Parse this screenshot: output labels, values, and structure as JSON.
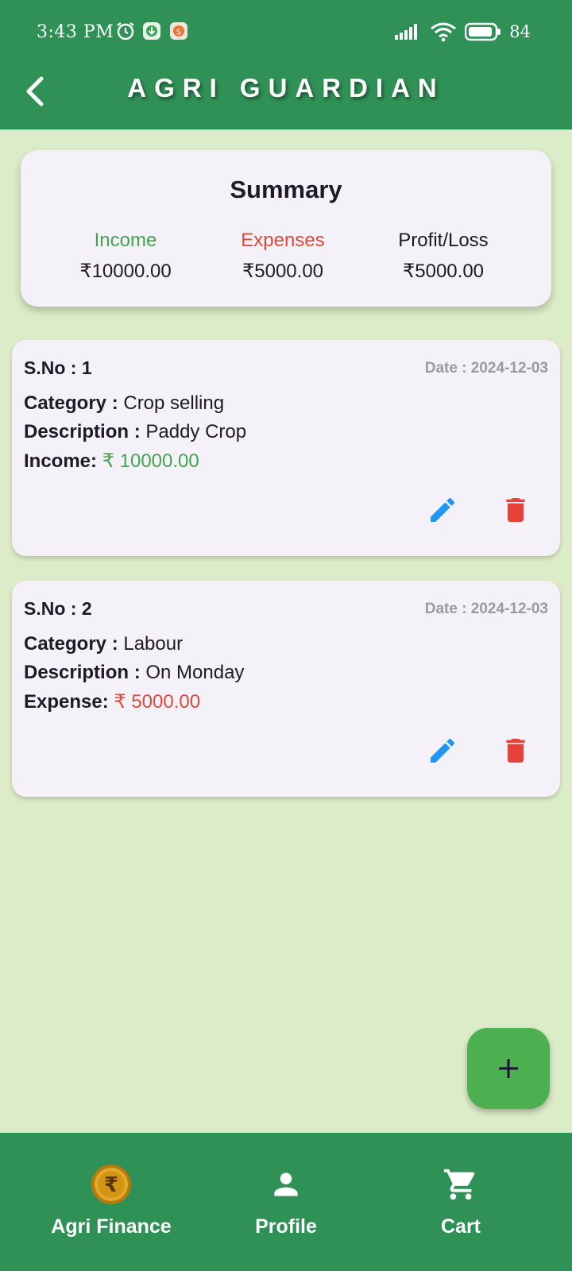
{
  "status_bar": {
    "time": "3:43 PM",
    "battery": "84"
  },
  "header": {
    "title": "AGRI GUARDIAN"
  },
  "summary": {
    "title": "Summary",
    "income_label": "Income",
    "income_value": "₹10000.00",
    "expenses_label": "Expenses",
    "expenses_value": "₹5000.00",
    "profit_label": "Profit/Loss",
    "profit_value": "₹5000.00"
  },
  "transactions": [
    {
      "sno": "S.No : 1",
      "date": "Date : 2024-12-03",
      "category_label": "Category :",
      "category": "Crop selling",
      "description_label": "Description :",
      "description": "Paddy Crop",
      "amount_label": "Income:",
      "amount": "₹ 10000.00",
      "type": "income"
    },
    {
      "sno": "S.No : 2",
      "date": "Date : 2024-12-03",
      "category_label": "Category :",
      "category": "Labour",
      "description_label": "Description :",
      "description": "On Monday",
      "amount_label": "Expense:",
      "amount": "₹ 5000.00",
      "type": "expense"
    }
  ],
  "bottom_nav": [
    {
      "label": "Agri Finance",
      "icon": "rupee-coin-icon"
    },
    {
      "label": "Profile",
      "icon": "person-icon"
    },
    {
      "label": "Cart",
      "icon": "cart-icon"
    }
  ],
  "colors": {
    "primary": "#2f9155",
    "background": "#ddecc8",
    "card": "#f5f1f8",
    "income": "#43a350",
    "expense": "#e0483c",
    "edit": "#2196f3",
    "fab": "#4caf50"
  }
}
